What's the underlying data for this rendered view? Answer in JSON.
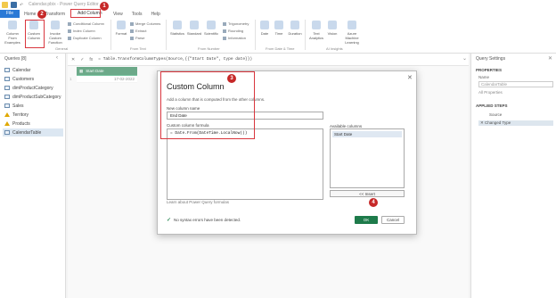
{
  "window": {
    "title": "Calendar.pbix - Power Query Editor"
  },
  "ribbon": {
    "tabs": [
      "File",
      "Home",
      "Transform",
      "Add Column",
      "View",
      "Tools",
      "Help"
    ],
    "buttons": {
      "column_from_examples": "Column From Examples",
      "custom_column": "Custom Column",
      "invoke_custom_function": "Invoke Custom Function",
      "conditional_column": "Conditional Column",
      "index_column": "Index Column",
      "duplicate_column": "Duplicate Column",
      "format": "Format",
      "abc_123": "ABC",
      "merge_columns": "Merge Columns",
      "extract": "Extract",
      "parse": "Parse",
      "statistics": "Statistics",
      "standard": "Standard",
      "scientific": "Scientific",
      "trigonometry": "Trigonometry",
      "rounding": "Rounding",
      "information": "Information",
      "date": "Date",
      "time": "Time",
      "duration": "Duration",
      "text_analytics": "Text Analytics",
      "vision": "Vision",
      "azure_ml": "Azure Machine Learning"
    },
    "groups": {
      "general": "General",
      "from_text": "From Text",
      "from_number": "From Number",
      "from_date_time": "From Date & Time",
      "ai_insights": "AI Insights"
    }
  },
  "badges": {
    "b1": "1",
    "b2": "2",
    "b3": "3",
    "b4": "4"
  },
  "queries": {
    "header": "Queries [8]",
    "items": [
      {
        "name": "Calendar",
        "icon": "table-icon"
      },
      {
        "name": "Customers",
        "icon": "table-icon"
      },
      {
        "name": "dimProductCategory",
        "icon": "table-icon"
      },
      {
        "name": "dimProductSubCategory",
        "icon": "table-icon"
      },
      {
        "name": "Sales",
        "icon": "table-icon"
      },
      {
        "name": "Territory",
        "icon": "warning-icon"
      },
      {
        "name": "Products",
        "icon": "warning-icon"
      },
      {
        "name": "CalendarTable",
        "icon": "table-icon",
        "selected": true
      }
    ]
  },
  "formula_bar": {
    "fx": "fx",
    "text": "= Table.TransformColumnTypes(Source,{{\"Start Date\", type date}})"
  },
  "grid": {
    "column_header": "Start Date",
    "row_number": "1",
    "cell_value": "17-02-2022"
  },
  "query_settings": {
    "title": "Query Settings",
    "properties_header": "PROPERTIES",
    "name_label": "Name",
    "name_value": "CalendarTable",
    "all_properties": "All Properties",
    "applied_steps_header": "APPLIED STEPS",
    "steps": [
      "Source",
      "Changed Type"
    ]
  },
  "dialog": {
    "title": "Custom Column",
    "subtitle": "Add a column that is computed from the other columns.",
    "new_column_label": "New column name",
    "new_column_value": "End Date",
    "formula_label": "Custom column formula",
    "formula_value": "= Date.From(DateTime.LocalNow())",
    "available_columns_label": "Available columns",
    "available_columns": [
      "Start Date"
    ],
    "insert_label": "<< Insert",
    "learn_link": "Learn about Power Query formulas",
    "status": "No syntax errors have been detected.",
    "ok_label": "OK",
    "cancel_label": "Cancel"
  },
  "colors": {
    "accent_green": "#1e7b4b",
    "file_blue": "#2b7ad6",
    "annotation_red": "#d9363e"
  }
}
